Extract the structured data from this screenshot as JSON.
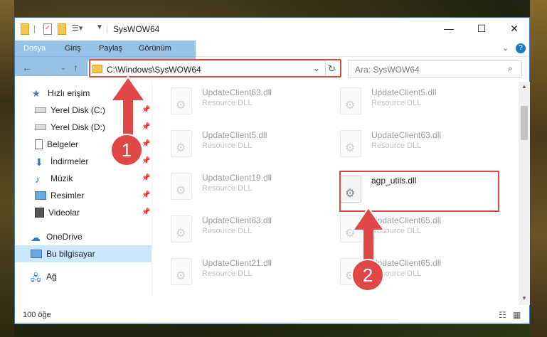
{
  "window": {
    "title": "SysWOW64"
  },
  "ribbon": {
    "tabs": [
      "Dosya",
      "Giriş",
      "Paylaş",
      "Görünüm"
    ]
  },
  "address": {
    "path": "C:\\Windows\\SysWOW64",
    "search_placeholder": "Ara: SysWOW64"
  },
  "nav": {
    "items": [
      {
        "label": "Hızlı erişim"
      },
      {
        "label": "Yerel Disk (C:)"
      },
      {
        "label": "Yerel Disk (D:)"
      },
      {
        "label": "Belgeler"
      },
      {
        "label": "İndirmeler"
      },
      {
        "label": "Müzik"
      },
      {
        "label": "Resimler"
      },
      {
        "label": "Videolar"
      },
      {
        "label": "OneDrive"
      },
      {
        "label": "Bu bilgisayar"
      },
      {
        "label": "Ağ"
      }
    ]
  },
  "files": [
    {
      "name": "UpdateClient63.dll",
      "type": "Resource DLL"
    },
    {
      "name": "UpdateClient5.dll",
      "type": "Resource DLL"
    },
    {
      "name": "UpdateClient5.dll",
      "type": "Resource DLL"
    },
    {
      "name": "UpdateClient63.dll",
      "type": "Resource DLL"
    },
    {
      "name": "UpdateClient19.dll",
      "type": "Resource DLL"
    },
    {
      "name": "agp_utils.dll",
      "type": ""
    },
    {
      "name": "UpdateClient63.dll",
      "type": "Resource DLL"
    },
    {
      "name": "UpdateClient65.dll",
      "type": "Resource DLL"
    },
    {
      "name": "UpdateClient21.dll",
      "type": "Resource DLL"
    },
    {
      "name": "UpdateClient65.dll",
      "type": "Resource DLL"
    }
  ],
  "status": {
    "count": "100 öğe"
  },
  "annotations": {
    "step1": "1",
    "step2": "2",
    "color": "#e04848"
  }
}
